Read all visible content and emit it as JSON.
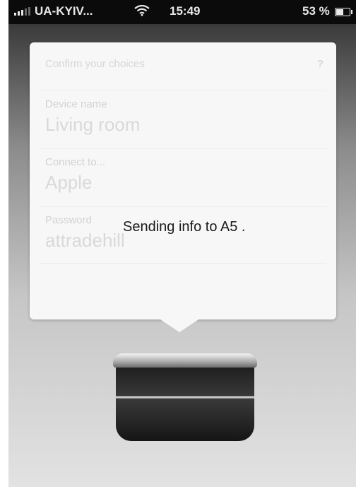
{
  "status_bar": {
    "carrier": "UA-KYIV...",
    "time": "15:49",
    "battery_percent": "53 %",
    "battery_level": 0.53,
    "signal_icon": "signal-bars-icon",
    "wifi_icon": "wifi-icon",
    "battery_icon": "battery-icon"
  },
  "card": {
    "title": "Confirm your choices",
    "help": "?",
    "fields": [
      {
        "label": "Device name",
        "value": "Living room"
      },
      {
        "label": "Connect to...",
        "value": "Apple"
      },
      {
        "label": "Password",
        "value": "attradehill"
      }
    ]
  },
  "overlay": {
    "sending_text": "Sending info to A5 ."
  },
  "colors": {
    "status_bar_bg": "#0b0b0b",
    "card_bg": "#f7f7f7",
    "faded_text": "#d6d6d6",
    "overlay_text": "#1a1a1a"
  }
}
